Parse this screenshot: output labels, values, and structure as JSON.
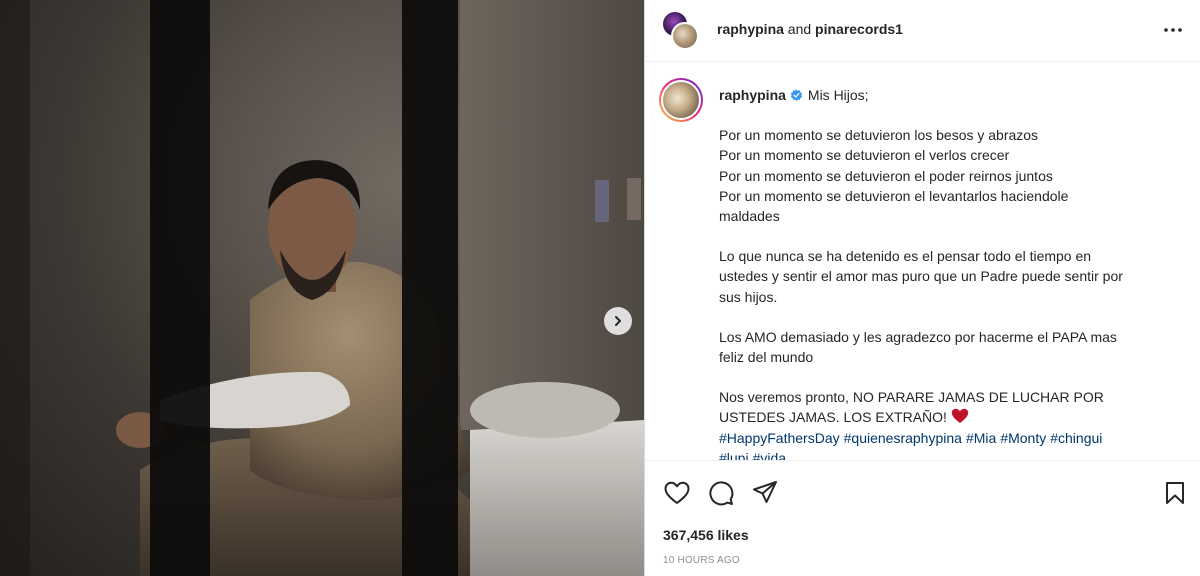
{
  "post": {
    "header": {
      "author": "raphypina",
      "connector": "and",
      "coauthor": "pinarecords1"
    },
    "caption": {
      "username": "raphypina",
      "first_line": "Mis Hijos;",
      "paragraphs": [
        [
          "Por un momento se detuvieron los besos y abrazos",
          "Por un momento se detuvieron el verlos crecer",
          "Por un momento se detuvieron el poder reirnos juntos",
          "Por un momento se detuvieron el levantarlos haciendole",
          "maldades"
        ],
        [
          "Lo que nunca se ha detenido es el pensar todo el tiempo en",
          "ustedes y sentir el amor mas puro que un Padre puede sentir por",
          "sus hijos."
        ],
        [
          "Los AMO demasiado y les agradezco por hacerme el PAPA mas",
          "feliz del mundo"
        ],
        [
          "Nos veremos pronto, NO PARARE JAMAS DE LUCHAR POR",
          "USTEDES JAMAS. LOS EXTRAÑO!"
        ]
      ],
      "hashtags": [
        "#HappyFathersDay",
        "#quienesraphypina",
        "#Mia",
        "#Monty",
        "#chingui",
        "#lupi",
        "#vida"
      ]
    },
    "likes": "367,456 likes",
    "time": "10 HOURS AGO",
    "icons": {
      "more": "more-options-icon",
      "verified": "verified-badge-icon",
      "like": "heart-outline-icon",
      "comment": "comment-bubble-icon",
      "share": "paper-plane-icon",
      "save": "bookmark-icon",
      "next": "chevron-right-icon"
    },
    "colors": {
      "verified": "#3897f0",
      "hashtag": "#00376b",
      "heart_emoji": "#c1122c",
      "muted": "#8e8e8e"
    }
  }
}
